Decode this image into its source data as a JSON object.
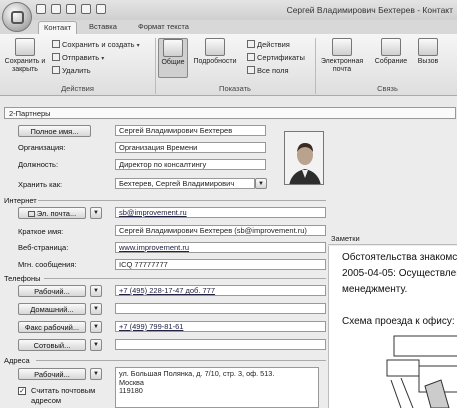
{
  "window": {
    "title": "Сергей Владимирович Бехтерев - Контакт"
  },
  "tabs": [
    "Контакт",
    "Вставка",
    "Формат текста"
  ],
  "ribbon": {
    "actions_group": {
      "label": "Действия",
      "save_close": "Сохранить и закрыть",
      "save_create": "Сохранить и создать",
      "send": "Отправить",
      "delete": "Удалить"
    },
    "show_group": {
      "label": "Показать",
      "general": "Общие",
      "details": "Подробности",
      "activities": "Действия",
      "certificates": "Сертификаты",
      "all_fields": "Все поля"
    },
    "comm_group": {
      "label": "Связь",
      "email": "Электронная почта",
      "meeting": "Собрание",
      "call": "Вызов"
    }
  },
  "section_title": "2-Партнеры",
  "contact": {
    "full_name_btn": "Полное имя...",
    "full_name": "Сергей Владимирович Бехтерев",
    "org_label": "Организация:",
    "org": "Организация Времени",
    "position_label": "Должность:",
    "position": "Директор по консалтингу",
    "file_as_label": "Хранить как:",
    "file_as": "Бехтерев, Сергей Владимирович"
  },
  "internet": {
    "header": "Интернет",
    "email_btn": "Эл. почта...",
    "email": "sb@improvement.ru",
    "display_label": "Краткое имя:",
    "display": "Сергей Владимирович Бехтерев (sb@improvement.ru)",
    "web_label": "Веб-страница:",
    "web": "www.improvement.ru",
    "im_label": "Мгн. сообщения:",
    "im": "ICQ 77777777"
  },
  "phones": {
    "header": "Телефоны",
    "items": [
      {
        "label": "Рабочий...",
        "value": "+7 (495) 228-17-47 доб. 777"
      },
      {
        "label": "Домашний...",
        "value": ""
      },
      {
        "label": "Факс рабочий...",
        "value": "+7 (499) 799-81-61"
      },
      {
        "label": "Сотовый...",
        "value": ""
      }
    ]
  },
  "address": {
    "header": "Адреса",
    "btn": "Рабочий...",
    "mailing_label_1": "Считать почтовым",
    "mailing_label_2": "адресом",
    "lines": [
      "ул. Большая Полянка, д. 7/10, стр. 3, оф. 513.",
      "Москва",
      "119180"
    ]
  },
  "notes": {
    "header": "Заметки",
    "lines": [
      "Обстоятельства знакомст",
      "2005-04-05: Осуществлен",
      "менеджменту.",
      "",
      "Схема проезда к офису:"
    ]
  }
}
